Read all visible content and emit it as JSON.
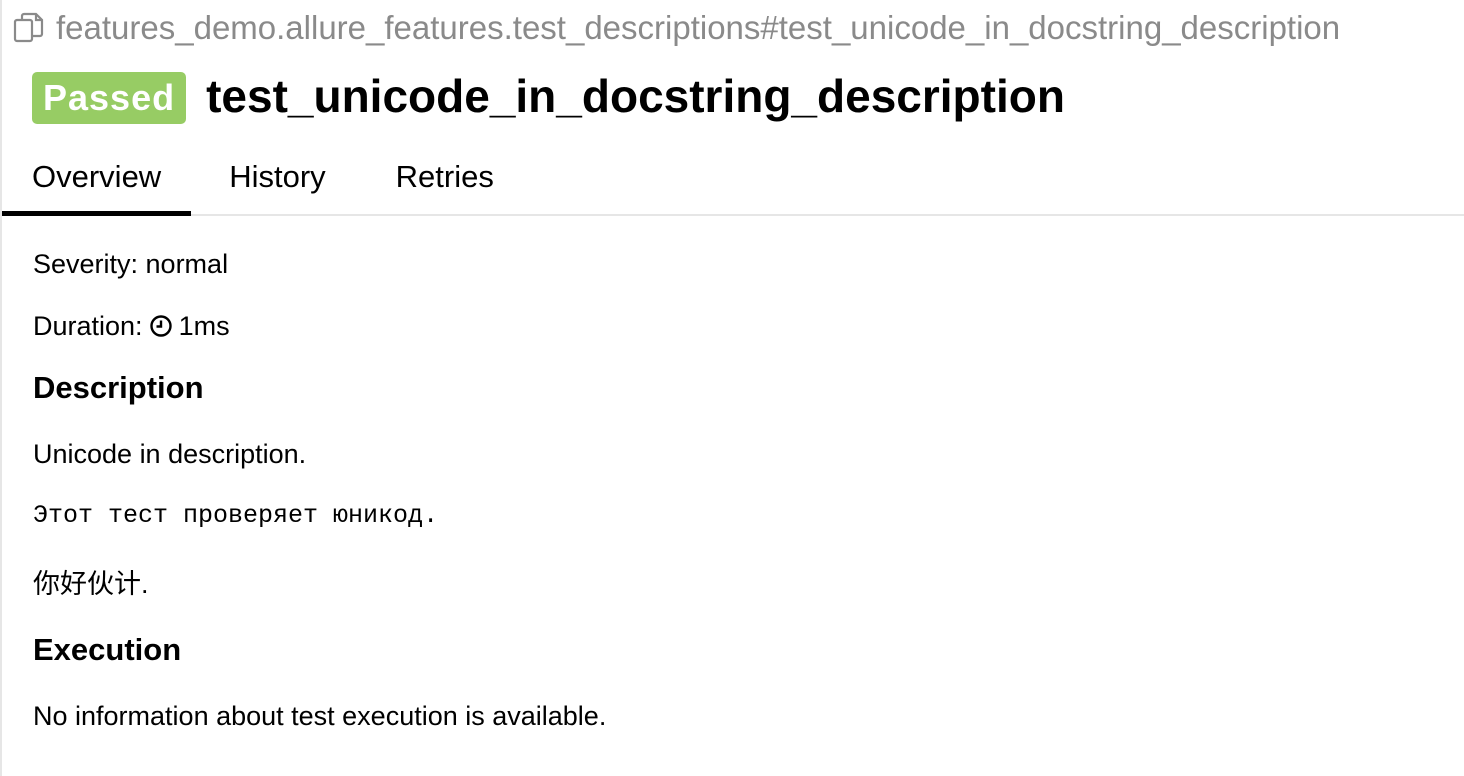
{
  "header": {
    "full_name": "features_demo.allure_features.test_descriptions#test_unicode_in_docstring_description",
    "copy_icon": "copy-icon",
    "status": "Passed",
    "status_color": "#97cc64",
    "title": "test_unicode_in_docstring_description"
  },
  "tabs": [
    {
      "label": "Overview",
      "active": true
    },
    {
      "label": "History",
      "active": false
    },
    {
      "label": "Retries",
      "active": false
    }
  ],
  "overview": {
    "severity": "Severity: normal",
    "duration_label": "Duration:",
    "duration_icon": "clock-icon",
    "duration_value": "1ms",
    "description_heading": "Description",
    "description_lines": [
      "Unicode in description.",
      "Этот тест проверяет юникод.",
      "你好伙计."
    ],
    "execution_heading": "Execution",
    "execution_text": "No information about test execution is available."
  }
}
